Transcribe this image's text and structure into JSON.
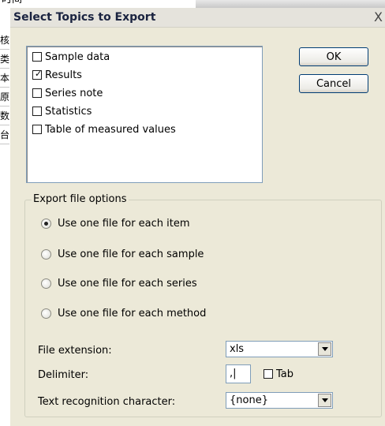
{
  "background": {
    "top_text": "时间",
    "side_cells": [
      "核",
      "类",
      "本",
      "原",
      "数",
      "台"
    ]
  },
  "dialog": {
    "title": "Select Topics to Export",
    "close_glyph": "X",
    "topics": [
      {
        "label": "Sample data",
        "checked": false
      },
      {
        "label": "Results",
        "checked": true
      },
      {
        "label": "Series note",
        "checked": false
      },
      {
        "label": "Statistics",
        "checked": false
      },
      {
        "label": "Table of measured values",
        "checked": false
      }
    ],
    "ok_label": "OK",
    "cancel_label": "Cancel",
    "export_group": {
      "label": "Export file options",
      "options": [
        {
          "label": "Use one file for each item",
          "selected": true
        },
        {
          "label": "Use one file for each sample",
          "selected": false
        },
        {
          "label": "Use one file for each series",
          "selected": false
        },
        {
          "label": "Use one file for each method",
          "selected": false
        }
      ],
      "file_extension_label": "File extension:",
      "file_extension_value": "xls",
      "delimiter_label": "Delimiter:",
      "delimiter_value": ",|",
      "tab_label": "Tab",
      "tab_checked": false,
      "text_recognition_label": "Text recognition character:",
      "text_recognition_value": "{none}"
    }
  }
}
